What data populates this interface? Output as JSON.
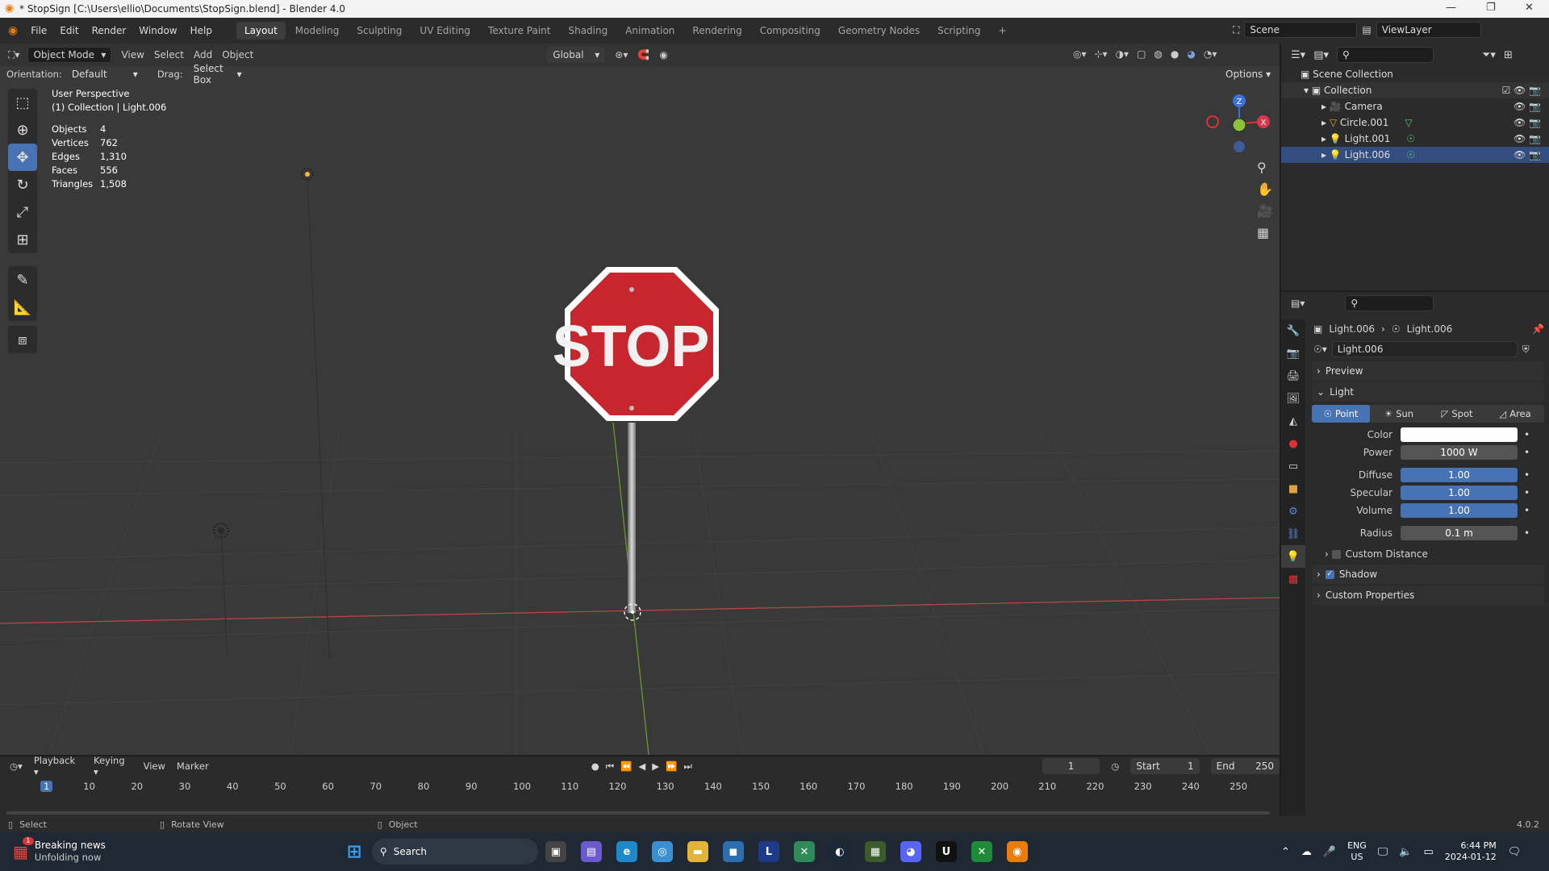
{
  "titlebar": {
    "title": "* StopSign [C:\\Users\\ellio\\Documents\\StopSign.blend] - Blender 4.0"
  },
  "menu": [
    "File",
    "Edit",
    "Render",
    "Window",
    "Help"
  ],
  "workspaces": [
    "Layout",
    "Modeling",
    "Sculpting",
    "UV Editing",
    "Texture Paint",
    "Shading",
    "Animation",
    "Rendering",
    "Compositing",
    "Geometry Nodes",
    "Scripting"
  ],
  "scene": {
    "name": "Scene",
    "view_layer": "ViewLayer"
  },
  "header": {
    "mode": "Object Mode",
    "view": "View",
    "select": "Select",
    "add": "Add",
    "object": "Object",
    "transform": "Global",
    "orientation_label": "Orientation:",
    "orientation": "Default",
    "drag_label": "Drag:",
    "drag": "Select Box",
    "options": "Options"
  },
  "viewport": {
    "perspective": "User Perspective",
    "context": "(1) Collection | Light.006",
    "stop_text": "STOP"
  },
  "stats": [
    {
      "label": "Objects",
      "value": "4"
    },
    {
      "label": "Vertices",
      "value": "762"
    },
    {
      "label": "Edges",
      "value": "1,310"
    },
    {
      "label": "Faces",
      "value": "556"
    },
    {
      "label": "Triangles",
      "value": "1,508"
    }
  ],
  "gizmo": {
    "z": "Z",
    "x": "X"
  },
  "outliner": {
    "root": "Scene Collection",
    "collection": "Collection",
    "items": [
      "Camera",
      "Circle.001",
      "Light.001",
      "Light.006"
    ]
  },
  "properties": {
    "breadcrumb_obj": "Light.006",
    "breadcrumb_data": "Light.006",
    "datablock": "Light.006",
    "panels": {
      "preview": "Preview",
      "light": "Light",
      "custom_distance": "Custom Distance",
      "shadow": "Shadow",
      "custom_props": "Custom Properties"
    },
    "light_types": [
      "Point",
      "Sun",
      "Spot",
      "Area"
    ],
    "fields": {
      "color": "Color",
      "power_label": "Power",
      "power": "1000 W",
      "diffuse_label": "Diffuse",
      "diffuse": "1.00",
      "specular_label": "Specular",
      "specular": "1.00",
      "volume_label": "Volume",
      "volume": "1.00",
      "radius_label": "Radius",
      "radius": "0.1 m"
    }
  },
  "timeline": {
    "playback": "Playback",
    "keying": "Keying",
    "view": "View",
    "marker": "Marker",
    "current": "1",
    "start_label": "Start",
    "start": "1",
    "end_label": "End",
    "end": "250",
    "ticks": [
      "1",
      "10",
      "20",
      "30",
      "40",
      "50",
      "60",
      "70",
      "80",
      "90",
      "100",
      "110",
      "120",
      "130",
      "140",
      "150",
      "160",
      "170",
      "180",
      "190",
      "200",
      "210",
      "220",
      "230",
      "240",
      "250"
    ]
  },
  "status": {
    "select": "Select",
    "rotate": "Rotate View",
    "object": "Object",
    "version": "4.0.2"
  },
  "taskbar": {
    "news_title": "Breaking news",
    "news_sub": "Unfolding now",
    "search": "Search",
    "lang": "ENG",
    "region": "US",
    "time": "6:44 PM",
    "date": "2024-01-12",
    "badge": "1"
  }
}
